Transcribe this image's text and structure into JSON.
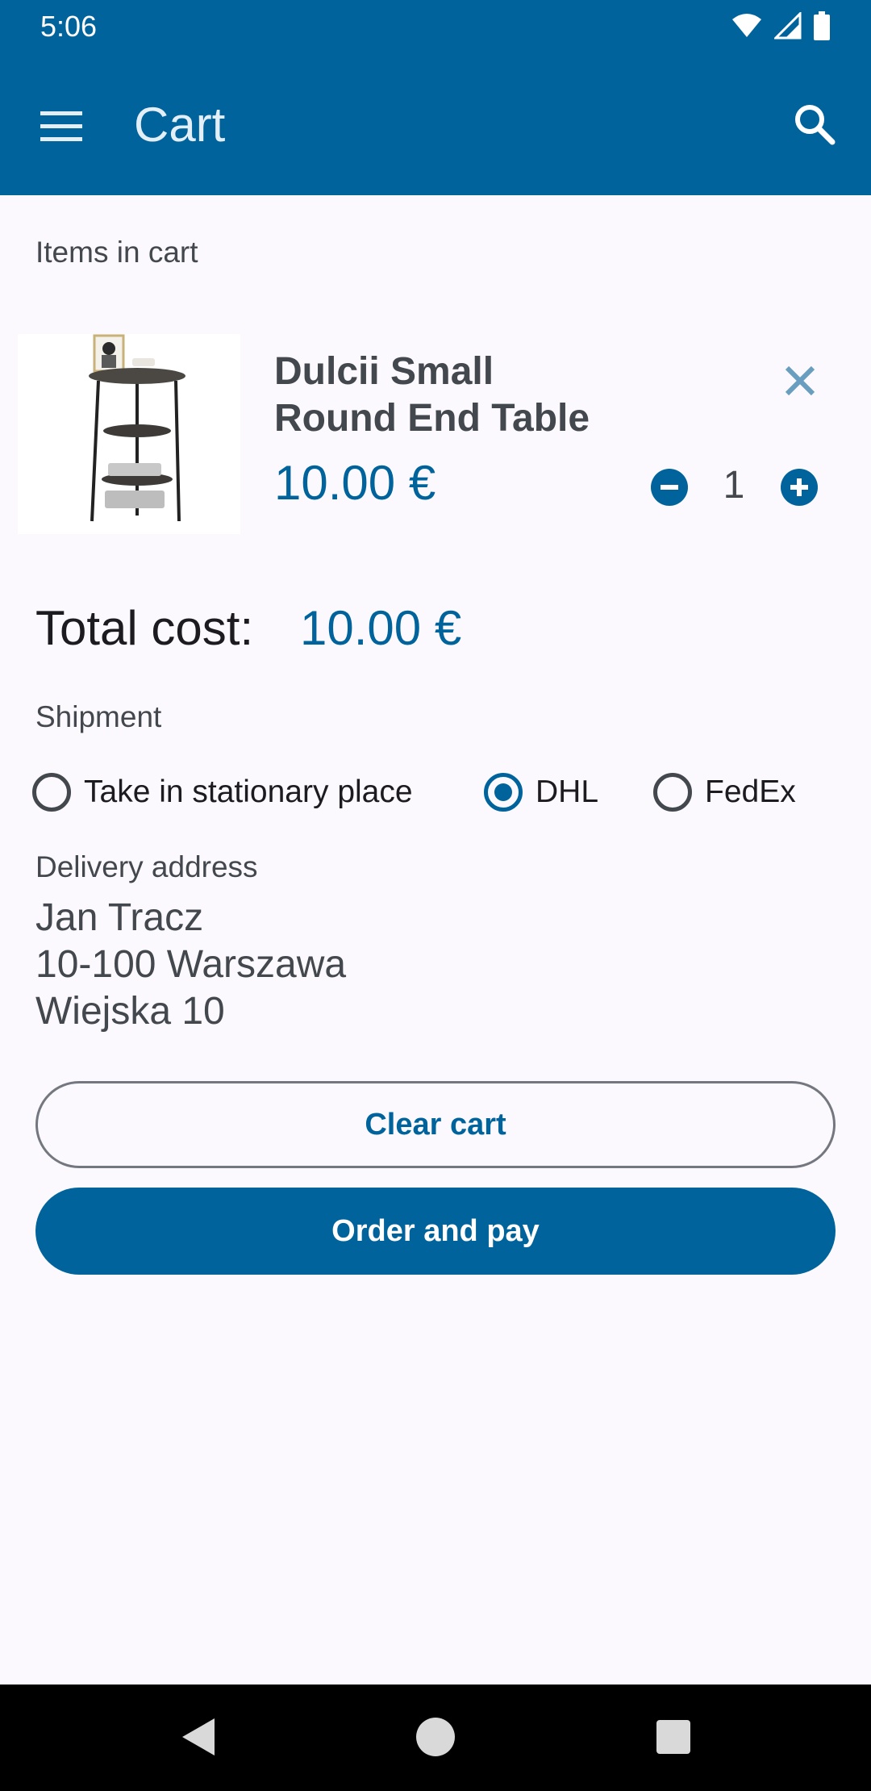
{
  "status_bar": {
    "time": "5:06",
    "icons": [
      "wifi-icon",
      "signal-icon",
      "battery-icon"
    ]
  },
  "app_bar": {
    "title": "Cart",
    "menu_icon": "menu-icon",
    "search_icon": "search-icon"
  },
  "cart": {
    "section_label": "Items in cart",
    "items": [
      {
        "name": "Dulcii Small Round End Table",
        "price": "10.00 €",
        "quantity": "1"
      }
    ]
  },
  "total": {
    "label": "Total cost:",
    "value": "10.00 €"
  },
  "shipment": {
    "label": "Shipment",
    "options": [
      {
        "label": "Take in stationary place",
        "selected": false
      },
      {
        "label": "DHL",
        "selected": true
      },
      {
        "label": "FedEx",
        "selected": false
      }
    ]
  },
  "delivery": {
    "label": "Delivery address",
    "lines": [
      "Jan Tracz",
      "10-100 Warszawa",
      "Wiejska 10"
    ]
  },
  "actions": {
    "clear_label": "Clear cart",
    "order_label": "Order and pay"
  },
  "colors": {
    "primary": "#00639c",
    "background": "#fbf9fd",
    "on_surface_variant": "#43474e"
  }
}
